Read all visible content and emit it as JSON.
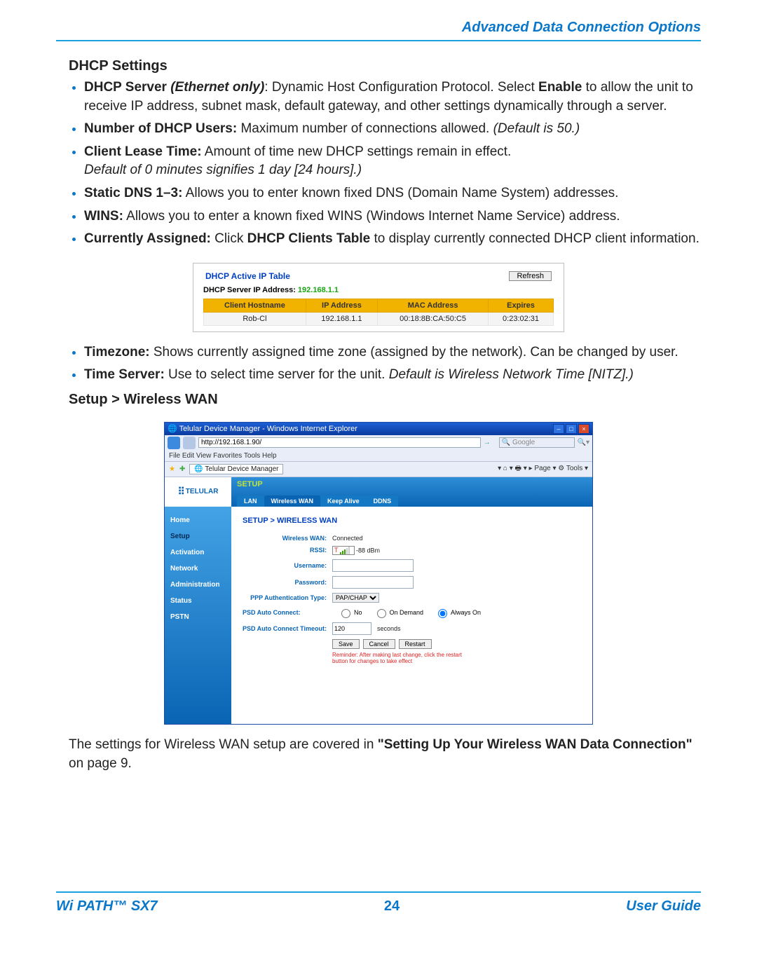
{
  "chapter_header": "Advanced Data Connection Options",
  "section1_title": "DHCP Settings",
  "bullets1": [
    {
      "bold": "DHCP Server ",
      "bolditalic": "(Ethernet only)",
      "post": ": Dynamic Host Configuration Protocol. Select ",
      "bold2": "Enable",
      "post2": " to allow the unit to receive IP address, subnet mask, default gateway, and other settings dynamically through a server."
    },
    {
      "bold": "Number of DHCP Users:",
      "post": " Maximum number of connections allowed. ",
      "italic": "(Default is 50.)"
    },
    {
      "bold": "Client Lease Time:",
      "post": " Amount of time new DHCP settings remain in effect.",
      "italic_block": "Default of 0 minutes signifies 1 day [24 hours].)"
    },
    {
      "bold": "Static DNS 1–3:",
      "post": " Allows you to enter known fixed DNS (Domain Name System) addresses."
    },
    {
      "bold": "WINS:",
      "post": " Allows you to enter a known fixed WINS (Windows Internet Name Service) address."
    },
    {
      "bold": "Currently Assigned:",
      "post": " Click ",
      "bold2": "DHCP Clients Table",
      "post2": " to display currently connected DHCP client information."
    }
  ],
  "dhcp_box": {
    "title": "DHCP Active IP Table",
    "server_label": "DHCP Server IP Address:",
    "server_ip": "192.168.1.1",
    "refresh": "Refresh",
    "headers": [
      "Client Hostname",
      "IP Address",
      "MAC Address",
      "Expires"
    ],
    "row": [
      "Rob-Cl",
      "192.168.1.1",
      "00:18:8B:CA:50:C5",
      "0:23:02:31"
    ]
  },
  "bullets2": [
    {
      "bold": "Timezone:",
      "post": " Shows currently assigned time zone (assigned by the network). Can be changed by user."
    },
    {
      "bold": "Time Server:",
      "post": " Use to select time server for the unit. ",
      "italic": "Default is Wireless Network Time [NITZ].)"
    }
  ],
  "section2_title": "Setup > Wireless WAN",
  "ie": {
    "title": "Telular Device Manager - Windows Internet Explorer",
    "url": "http://192.168.1.90/",
    "search_hint": "Google",
    "menu": "File   Edit   View   Favorites   Tools   Help",
    "tab": "Telular Device Manager",
    "tools": "▾   ⌂ ▾   🖶 ▾ ▸ Page ▾ ⚙ Tools ▾"
  },
  "telular": {
    "logo": "TELULAR",
    "setup_label": "SETUP",
    "tabs": [
      "LAN",
      "Wireless WAN",
      "Keep Alive",
      "DDNS"
    ],
    "nav": [
      "Home",
      "Setup",
      "Activation",
      "Network",
      "Administration",
      "Status",
      "PSTN"
    ],
    "breadcrumb": "SETUP > WIRELESS WAN",
    "fields": {
      "wireless_wan_label": "Wireless WAN:",
      "wireless_wan_value": "Connected",
      "rssi_label": "RSSI:",
      "rssi_value": "-88 dBm",
      "username_label": "Username:",
      "password_label": "Password:",
      "ppp_label": "PPP Authentication Type:",
      "ppp_value": "PAP/CHAP",
      "psd_auto_label": "PSD Auto Connect:",
      "radios": [
        "No",
        "On Demand",
        "Always On"
      ],
      "psd_timeout_label": "PSD Auto Connect Timeout:",
      "psd_timeout_value": "120",
      "psd_timeout_unit": "seconds",
      "buttons": [
        "Save",
        "Cancel",
        "Restart"
      ],
      "reminder": "Reminder: After making last change, click the restart button for changes to take effect"
    }
  },
  "closing_para_pre": "The settings for Wireless WAN setup are covered in ",
  "closing_para_bold": "\"Setting Up Your Wireless WAN Data Connection\"",
  "closing_para_post": " on page 9.",
  "footer": {
    "left": "Wi PATH™ SX7",
    "center": "24",
    "right": "User Guide"
  }
}
